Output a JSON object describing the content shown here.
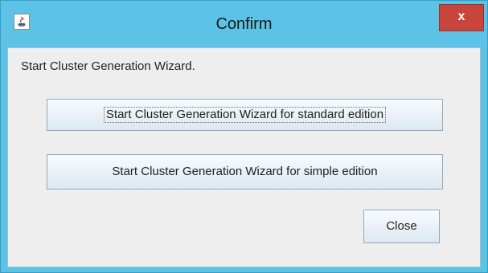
{
  "window": {
    "title": "Confirm",
    "app_icon": "java-cup-icon",
    "close_glyph": "x"
  },
  "dialog": {
    "message": "Start Cluster Generation Wizard.",
    "buttons": {
      "standard_label": "Start Cluster Generation Wizard for standard edition",
      "simple_label": "Start Cluster Generation Wizard for simple edition",
      "close_label": "Close"
    }
  },
  "colors": {
    "titlebar": "#5cc3e6",
    "close_button": "#c7453a",
    "content_bg": "#eeeeee"
  }
}
